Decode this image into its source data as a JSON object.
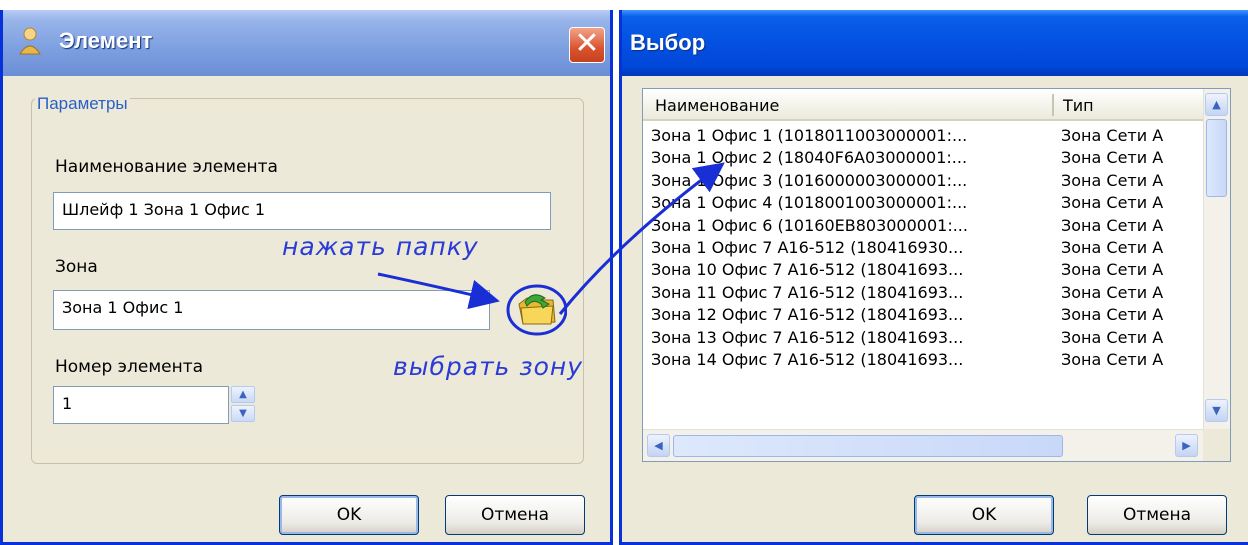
{
  "element_dialog": {
    "title": "Элемент",
    "close_glyph": "✕",
    "group_title": "Параметры",
    "name_label": "Наименование элемента",
    "name_value": "Шлейф 1 Зона 1 Офис 1",
    "zone_label": "Зона",
    "zone_value": "Зона 1 Офис 1",
    "number_label": "Номер элемента",
    "number_value": "1",
    "ok_label": "OK",
    "cancel_label": "Отмена",
    "icons": [
      "user-icon",
      "close-icon",
      "folder-browse-icon",
      "spin-up-icon",
      "spin-down-icon"
    ]
  },
  "annotations": {
    "press_folder": "нажать папку",
    "choose_zone": "выбрать зону",
    "arrow_color": "#1a2ed6"
  },
  "selection_dialog": {
    "title": "Выбор",
    "columns": [
      "Наименование",
      "Тип"
    ],
    "rows": [
      {
        "name": "Зона 1 Офис 1 (1018011003000001:...",
        "type": "Зона Сети А"
      },
      {
        "name": "Зона 1 Офис 2 (18040F6A03000001:...",
        "type": "Зона Сети А"
      },
      {
        "name": "Зона 1 Офис 3 (1016000003000001:...",
        "type": "Зона Сети А"
      },
      {
        "name": "Зона 1 Офис 4 (1018001003000001:...",
        "type": "Зона Сети А"
      },
      {
        "name": "Зона 1 Офис 6 (10160EB803000001:...",
        "type": "Зона Сети А"
      },
      {
        "name": "Зона 1 Офис 7 А16-512 (180416930...",
        "type": "Зона Сети А"
      },
      {
        "name": "Зона 10 Офис 7 А16-512 (18041693...",
        "type": "Зона Сети А"
      },
      {
        "name": "Зона 11 Офис 7 А16-512 (18041693...",
        "type": "Зона Сети А"
      },
      {
        "name": "Зона 12 Офис 7 А16-512 (18041693...",
        "type": "Зона Сети А"
      },
      {
        "name": "Зона 13 Офис 7 А16-512 (18041693...",
        "type": "Зона Сети А"
      },
      {
        "name": "Зона 14 Офис 7 А16-512 (18041693...",
        "type": "Зона Сети А"
      }
    ],
    "ok_label": "OK",
    "cancel_label": "Отмена"
  },
  "colors": {
    "xp_blue": "#0831d9",
    "dialog_bg": "#ece9d8",
    "group_title": "#2b5fc6"
  }
}
